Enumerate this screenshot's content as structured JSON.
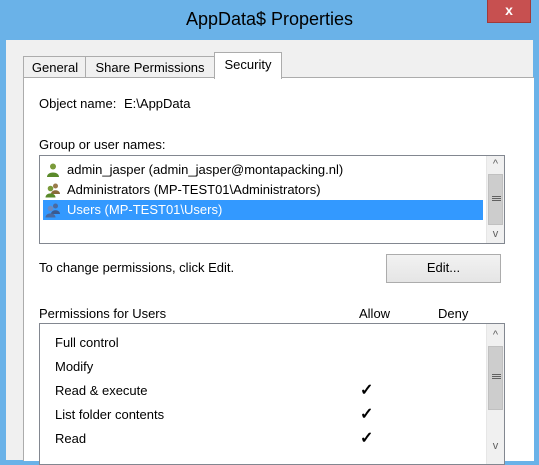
{
  "window": {
    "title": "AppData$ Properties",
    "close_glyph": "x"
  },
  "tabs": [
    {
      "label": "General"
    },
    {
      "label": "Share Permissions"
    },
    {
      "label": "Security"
    }
  ],
  "security": {
    "object_label": "Object name:",
    "object_value": "E:\\AppData",
    "group_label": "Group or user names:",
    "users": [
      {
        "name": "admin_jasper (admin_jasper@montapacking.nl)",
        "icon": "single-user-icon"
      },
      {
        "name": "Administrators (MP-TEST01\\Administrators)",
        "icon": "group-users-icon"
      },
      {
        "name": "Users (MP-TEST01\\Users)",
        "icon": "group-users-icon",
        "selected": true
      }
    ],
    "change_hint": "To change permissions, click Edit.",
    "edit_label": "Edit...",
    "permissions_label": "Permissions for Users",
    "allow_label": "Allow",
    "deny_label": "Deny",
    "permissions": [
      {
        "name": "Full control",
        "allow": false,
        "deny": false
      },
      {
        "name": "Modify",
        "allow": false,
        "deny": false
      },
      {
        "name": "Read & execute",
        "allow": true,
        "deny": false
      },
      {
        "name": "List folder contents",
        "allow": true,
        "deny": false
      },
      {
        "name": "Read",
        "allow": true,
        "deny": false
      }
    ],
    "check_glyph": "✓",
    "scroll_up_glyph": "^",
    "scroll_down_glyph": "v"
  },
  "colors": {
    "title_bg": "#6ab2e8",
    "close_bg": "#c75050",
    "selection": "#3399ff"
  }
}
